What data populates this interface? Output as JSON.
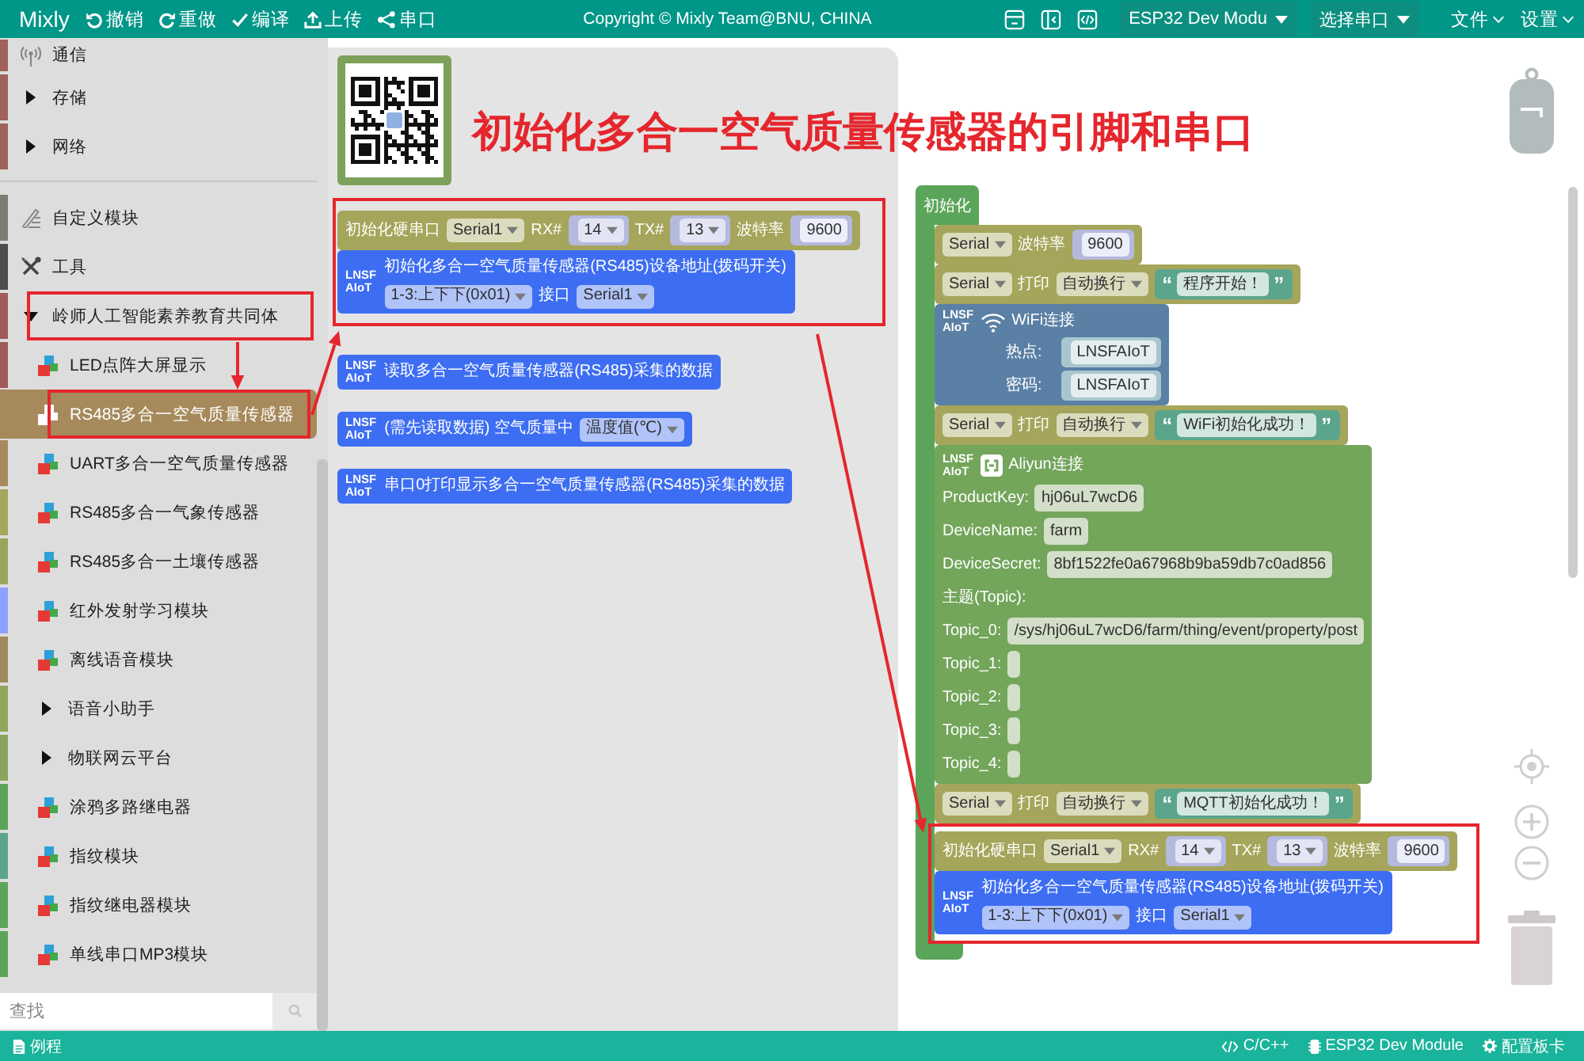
{
  "toolbar": {
    "logo": "Mixly",
    "actions": [
      {
        "kind": "undo",
        "label": "撤销"
      },
      {
        "kind": "redo",
        "label": "重做"
      },
      {
        "kind": "compile",
        "label": "编译"
      },
      {
        "kind": "upload",
        "label": "上传"
      },
      {
        "kind": "serial",
        "label": "串口"
      }
    ],
    "copyright": "Copyright © Mixly Team@BNU, CHINA",
    "board_select": "ESP32 Dev Modu",
    "port_select": "选择串口",
    "menus": [
      "文件",
      "设置"
    ]
  },
  "sidebar": {
    "sections": [
      {
        "items": [
          {
            "label": "通信",
            "kind": "signal",
            "color": "#a0615a",
            "selected": false,
            "highlighted": false
          },
          {
            "label": "存储",
            "kind": "folder",
            "color": "#a0615a",
            "selected": false,
            "highlighted": false,
            "expanded": false
          },
          {
            "label": "网络",
            "kind": "folder",
            "color": "#a0615a",
            "selected": false,
            "highlighted": false,
            "expanded": false
          }
        ]
      },
      {
        "items": [
          {
            "label": "自定义模块",
            "kind": "custom",
            "color": "#7d7d73",
            "selected": false,
            "highlighted": false
          },
          {
            "label": "工具",
            "kind": "tools",
            "color": "#4d4d4d",
            "selected": false,
            "highlighted": false
          },
          {
            "label": "岭师人工智能素养教育共同体",
            "kind": "folder",
            "color": "#a05a5a",
            "selected": false,
            "highlighted": true,
            "expanded": true,
            "children": [
              {
                "label": "LED点阵大屏显示",
                "kind": "module",
                "color": "#a05a5a",
                "selected": false,
                "highlighted": false
              },
              {
                "label": "RS485多合一空气质量传感器",
                "kind": "module",
                "color": "#a68a5c",
                "selected": true,
                "highlighted": true
              },
              {
                "label": "UART多合一空气质量传感器",
                "kind": "module",
                "color": "#a68a5c",
                "selected": false,
                "highlighted": false
              },
              {
                "label": "RS485多合一气象传感器",
                "kind": "module",
                "color": "#a5a55b",
                "selected": false,
                "highlighted": false
              },
              {
                "label": "RS485多合一土壤传感器",
                "kind": "module",
                "color": "#9aa55b",
                "selected": false,
                "highlighted": false
              },
              {
                "label": "红外发射学习模块",
                "kind": "module",
                "color": "#8ca0ff",
                "selected": false,
                "highlighted": false
              },
              {
                "label": "离线语音模块",
                "kind": "module",
                "color": "#a08a5b",
                "selected": false,
                "highlighted": false
              },
              {
                "label": "语音小助手",
                "kind": "folder",
                "color": "#93a55b",
                "selected": false,
                "highlighted": false,
                "expanded": false
              },
              {
                "label": "物联网云平台",
                "kind": "folder",
                "color": "#8aa55b",
                "selected": false,
                "highlighted": false,
                "expanded": false
              },
              {
                "label": "涂鸦多路继电器",
                "kind": "module",
                "color": "#5ba55b",
                "selected": false,
                "highlighted": false
              },
              {
                "label": "指纹模块",
                "kind": "module",
                "color": "#5ba58a",
                "selected": false,
                "highlighted": false
              },
              {
                "label": "指纹继电器模块",
                "kind": "module",
                "color": "#5ba55b",
                "selected": false,
                "highlighted": false
              },
              {
                "label": "单线串口MP3模块",
                "kind": "module",
                "color": "#5ba55b",
                "selected": false,
                "highlighted": false
              }
            ]
          }
        ]
      }
    ],
    "search": {
      "placeholder": "查找"
    }
  },
  "flyout": {
    "image": {
      "kind": "qr_code"
    },
    "groups": [
      {
        "kind": "highlight",
        "blocks": [
          {
            "kind": "serial",
            "rows": [
              [
                {
                  "kind": "label",
                  "text": "初始化硬串口"
                },
                {
                  "kind": "dropdown",
                  "text": "Serial1"
                },
                {
                  "kind": "label",
                  "text": "RX#"
                },
                {
                  "kind": "pin",
                  "text": "14"
                },
                {
                  "kind": "label",
                  "text": "TX#"
                },
                {
                  "kind": "pin",
                  "text": "13"
                },
                {
                  "kind": "label",
                  "text": "波特率"
                },
                {
                  "kind": "number",
                  "text": "9600"
                }
              ]
            ]
          },
          {
            "kind": "sensor",
            "logo": "LNSF AIoT",
            "rows": [
              [
                {
                  "kind": "label",
                  "text": "初始化多合一空气质量传感器(RS485)设备地址(拨码开关)"
                }
              ],
              [
                {
                  "kind": "dropdown",
                  "text": "1-3:上下下(0x01)"
                },
                {
                  "kind": "label",
                  "text": "接口"
                },
                {
                  "kind": "dropdown",
                  "text": "Serial1"
                }
              ]
            ]
          }
        ]
      },
      {
        "kind": "stack",
        "blocks": [
          {
            "kind": "sensor",
            "logo": "LNSF AIoT",
            "rows": [
              [
                {
                  "kind": "label",
                  "text": "读取多合一空气质量传感器(RS485)采集的数据"
                }
              ]
            ]
          }
        ]
      },
      {
        "kind": "stack",
        "blocks": [
          {
            "kind": "sensor",
            "logo": "LNSF AIoT",
            "rows": [
              [
                {
                  "kind": "label",
                  "text": "(需先读取数据) 空气质量中"
                },
                {
                  "kind": "dropdown",
                  "text": "温度值(℃)"
                }
              ]
            ]
          }
        ]
      },
      {
        "kind": "stack",
        "blocks": [
          {
            "kind": "sensor",
            "logo": "LNSF AIoT",
            "rows": [
              [
                {
                  "kind": "label",
                  "text": "串口0打印显示多合一空气质量传感器(RS485)采集的数据"
                }
              ]
            ]
          }
        ]
      }
    ]
  },
  "annotation": {
    "title": "初始化多合一空气质量传感器的引脚和串口"
  },
  "workspace": {
    "blocks": [
      {
        "kind": "setup",
        "label": "初始化",
        "groups": [
          {
            "kind": "stack",
            "blocks": [
              {
                "kind": "serial",
                "rows": [
                  [
                    {
                      "kind": "dropdown",
                      "text": "Serial"
                    },
                    {
                      "kind": "label",
                      "text": "波特率"
                    },
                    {
                      "kind": "number",
                      "text": "9600"
                    }
                  ]
                ]
              },
              {
                "kind": "serial",
                "rows": [
                  [
                    {
                      "kind": "dropdown",
                      "text": "Serial"
                    },
                    {
                      "kind": "label",
                      "text": "打印"
                    },
                    {
                      "kind": "dropdown",
                      "text": "自动换行"
                    },
                    {
                      "kind": "string",
                      "open": "“",
                      "text": "程序开始！",
                      "close": "”"
                    }
                  ]
                ]
              },
              {
                "kind": "wifi",
                "logo": "LNSF AIoT",
                "title": "WiFi连接",
                "rows": [
                  [
                    {
                      "kind": "label",
                      "text": "热点:"
                    },
                    {
                      "kind": "text_block",
                      "text": "LNSFAIoT"
                    }
                  ],
                  [
                    {
                      "kind": "label",
                      "text": "密码:"
                    },
                    {
                      "kind": "text_block",
                      "text": "LNSFAIoT"
                    }
                  ]
                ]
              },
              {
                "kind": "serial",
                "rows": [
                  [
                    {
                      "kind": "dropdown",
                      "text": "Serial"
                    },
                    {
                      "kind": "label",
                      "text": "打印"
                    },
                    {
                      "kind": "dropdown",
                      "text": "自动换行"
                    },
                    {
                      "kind": "string",
                      "open": "“",
                      "text": "WiFi初始化成功！",
                      "close": "”"
                    }
                  ]
                ]
              },
              {
                "kind": "aliyun",
                "logo": "LNSF AIoT",
                "title": "Aliyun连接",
                "rows": [
                  [
                    {
                      "kind": "label",
                      "text": "ProductKey:"
                    },
                    {
                      "kind": "input",
                      "text": "hj06uL7wcD6"
                    }
                  ],
                  [
                    {
                      "kind": "label",
                      "text": "DeviceName:"
                    },
                    {
                      "kind": "input",
                      "text": "farm"
                    }
                  ],
                  [
                    {
                      "kind": "label",
                      "text": "DeviceSecret:"
                    },
                    {
                      "kind": "input",
                      "text": "8bf1522fe0a67968b9ba59db7c0ad856"
                    }
                  ],
                  [
                    {
                      "kind": "label",
                      "text": "主题(Topic):"
                    }
                  ],
                  [
                    {
                      "kind": "label",
                      "text": "Topic_0:"
                    },
                    {
                      "kind": "input",
                      "text": "/sys/hj06uL7wcD6/farm/thing/event/property/post"
                    }
                  ],
                  [
                    {
                      "kind": "label",
                      "text": "Topic_1:"
                    },
                    {
                      "kind": "input"
                    }
                  ],
                  [
                    {
                      "kind": "label",
                      "text": "Topic_2:"
                    },
                    {
                      "kind": "input"
                    }
                  ],
                  [
                    {
                      "kind": "label",
                      "text": "Topic_3:"
                    },
                    {
                      "kind": "input"
                    }
                  ],
                  [
                    {
                      "kind": "label",
                      "text": "Topic_4:"
                    },
                    {
                      "kind": "input"
                    }
                  ]
                ]
              },
              {
                "kind": "serial",
                "rows": [
                  [
                    {
                      "kind": "dropdown",
                      "text": "Serial"
                    },
                    {
                      "kind": "label",
                      "text": "打印"
                    },
                    {
                      "kind": "dropdown",
                      "text": "自动换行"
                    },
                    {
                      "kind": "string",
                      "open": "“",
                      "text": "MQTT初始化成功！",
                      "close": "”"
                    }
                  ]
                ]
              }
            ]
          },
          {
            "kind": "highlight",
            "blocks": [
              {
                "kind": "serial",
                "rows": [
                  [
                    {
                      "kind": "label",
                      "text": "初始化硬串口"
                    },
                    {
                      "kind": "dropdown",
                      "text": "Serial1"
                    },
                    {
                      "kind": "label",
                      "text": "RX#"
                    },
                    {
                      "kind": "pin",
                      "text": "14"
                    },
                    {
                      "kind": "label",
                      "text": "TX#"
                    },
                    {
                      "kind": "pin",
                      "text": "13"
                    },
                    {
                      "kind": "label",
                      "text": "波特率"
                    },
                    {
                      "kind": "number",
                      "text": "9600"
                    }
                  ]
                ]
              },
              {
                "kind": "sensor",
                "logo": "LNSF AIoT",
                "rows": [
                  [
                    {
                      "kind": "label",
                      "text": "初始化多合一空气质量传感器(RS485)设备地址(拨码开关)"
                    }
                  ],
                  [
                    {
                      "kind": "dropdown",
                      "text": "1-3:上下下(0x01)"
                    },
                    {
                      "kind": "label",
                      "text": "接口"
                    },
                    {
                      "kind": "dropdown",
                      "text": "Serial1"
                    }
                  ]
                ]
              }
            ]
          }
        ]
      }
    ]
  },
  "status_bar": {
    "left": {
      "kind": "examples",
      "label": "例程"
    },
    "right": [
      {
        "kind": "language",
        "label": "C/C++"
      },
      {
        "kind": "board",
        "label": "ESP32 Dev Module"
      },
      {
        "kind": "config",
        "label": "配置板卡"
      }
    ]
  }
}
